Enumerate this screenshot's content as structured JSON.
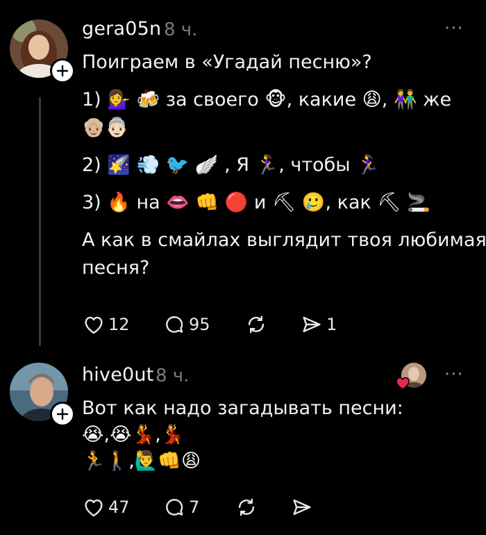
{
  "posts": [
    {
      "username": "gera05n",
      "time": "8 ч.",
      "more": "···",
      "lines": [
        "Поиграем в «Угадай песню»?",
        "1) 💁‍♀️ 🍻 за своего 🐵, какие 😩, 👫 же",
        "👴🏼👵🏻",
        "2) 🌠 💨 🐦 🪽 , Я 🏃‍♀️, чтобы 🏃‍♀️￼",
        "3) 🔥 на 👄 👊 🔴 и ⛏ 🥲, как ⛏ 🚬",
        "А как в смайлах выглядит твоя любимая",
        "песня?"
      ],
      "likes": "12",
      "comments": "95",
      "shares": "1",
      "icons": {
        "like": "heart-icon",
        "comment": "comment-icon",
        "repost": "repost-icon",
        "share": "send-icon",
        "follow": "plus-icon"
      }
    },
    {
      "username": "hive0ut",
      "time": "8 ч.",
      "more": "···",
      "lines": [
        "Вот как надо загадывать песни:",
        "😭,😭💃,💃",
        "🏃🚶,🙋‍♂️👊😩"
      ],
      "likes": "47",
      "comments": "7",
      "icons": {
        "like": "heart-icon",
        "comment": "comment-icon",
        "repost": "repost-icon",
        "share": "send-icon",
        "follow": "plus-icon",
        "liked_by": "red-heart-icon"
      }
    }
  ],
  "colors": {
    "background": "#000000",
    "text": "#f3f3f3",
    "muted": "#7a7a7a",
    "heart": "#e8274b"
  }
}
